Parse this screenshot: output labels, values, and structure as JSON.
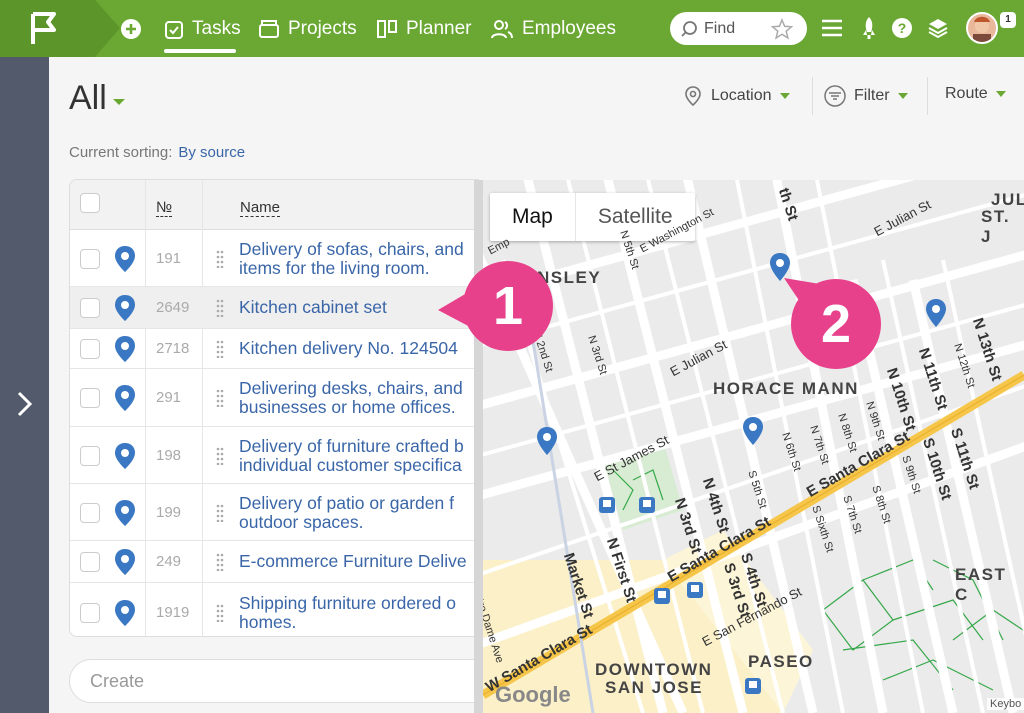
{
  "nav": {
    "tasks": "Tasks",
    "projects": "Projects",
    "planner": "Planner",
    "employees": "Employees",
    "find_placeholder": "Find",
    "notification_count": "1"
  },
  "page": {
    "title": "All",
    "location": "Location",
    "filter": "Filter",
    "route": "Route",
    "sorting_label": "Current sorting:",
    "sorting_value": "By source",
    "create_placeholder": "Create"
  },
  "table": {
    "col_no": "№",
    "col_name": "Name",
    "rows": [
      {
        "num": "191",
        "line1": "Delivery of sofas, chairs, and",
        "line2": "items for the living room."
      },
      {
        "num": "2649",
        "line1": "Kitchen cabinet set",
        "line2": ""
      },
      {
        "num": "2718",
        "line1": "Kitchen delivery No. 124504",
        "line2": ""
      },
      {
        "num": "291",
        "line1": "Delivering desks, chairs, and",
        "line2": "businesses or home offices."
      },
      {
        "num": "198",
        "line1": "Delivery of furniture crafted b",
        "line2": "individual customer specifica"
      },
      {
        "num": "199",
        "line1": "Delivery of patio or garden f",
        "line2": "outdoor spaces."
      },
      {
        "num": "249",
        "line1": "E-commerce Furniture Delive",
        "line2": ""
      },
      {
        "num": "1919",
        "line1": "Shipping furniture ordered o",
        "line2": "homes."
      }
    ]
  },
  "map": {
    "map_tab": "Map",
    "satellite_tab": "Satellite",
    "areas": [
      "HORACE MANN",
      "DOWNTOWN",
      "SAN JOSE",
      "PASEO",
      "EAST C",
      "JUL",
      "ST. J",
      "NSLEY"
    ],
    "streets": [
      "E Julian St",
      "N 5th St",
      "E Washington St",
      "N 3rd St",
      "N 2nd St",
      "E St James St",
      "N 4th St",
      "N First St",
      "Market St",
      "E Santa Clara St",
      "W Santa Clara St",
      "E San Fernando St",
      "S 4th St",
      "S 3rd St",
      "N 6th St",
      "N 7th St",
      "N 8th St",
      "N 9th St",
      "N 10th St",
      "N 11th St",
      "N 12th St",
      "N 13th St",
      "S 5th St",
      "S 6th St",
      "S 7th St",
      "S 8th St",
      "S 9th St",
      "S 10th St",
      "S 11th St",
      "S Sixth St",
      "Notre Dame Ave",
      "th St",
      "Emp"
    ],
    "keyboard": "Keybo",
    "google": "Google"
  },
  "callouts": [
    "1",
    "2"
  ],
  "colors": {
    "brand_green": "#6aa733",
    "link_blue": "#3a66a8",
    "pin_blue": "#3b78c4",
    "callout_pink": "#e8418c"
  }
}
